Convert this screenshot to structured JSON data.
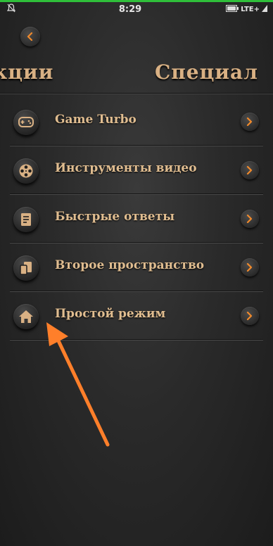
{
  "status_bar": {
    "time": "8:29",
    "network": "LTE+",
    "icons": [
      "alarm-off-icon",
      "signal-icon"
    ]
  },
  "header": {
    "back_icon": "chevron-left-icon",
    "tabs": [
      {
        "label": "кции"
      },
      {
        "label": "Специал"
      }
    ]
  },
  "menu": {
    "items": [
      {
        "label": "Game Turbo",
        "icon": "gamepad-icon"
      },
      {
        "label": "Инструменты видео",
        "icon": "film-reel-icon"
      },
      {
        "label": "Быстрые ответы",
        "icon": "document-icon"
      },
      {
        "label": "Второе пространство",
        "icon": "dual-space-icon"
      },
      {
        "label": "Простой режим",
        "icon": "home-icon"
      }
    ]
  },
  "annotation": {
    "arrow_color": "#ff7f2a",
    "points_to": "Простой режим"
  },
  "colors": {
    "accent_text": "#d9b184",
    "chevron_orange": "#f08a2c",
    "status_green": "#2fbf3a"
  }
}
